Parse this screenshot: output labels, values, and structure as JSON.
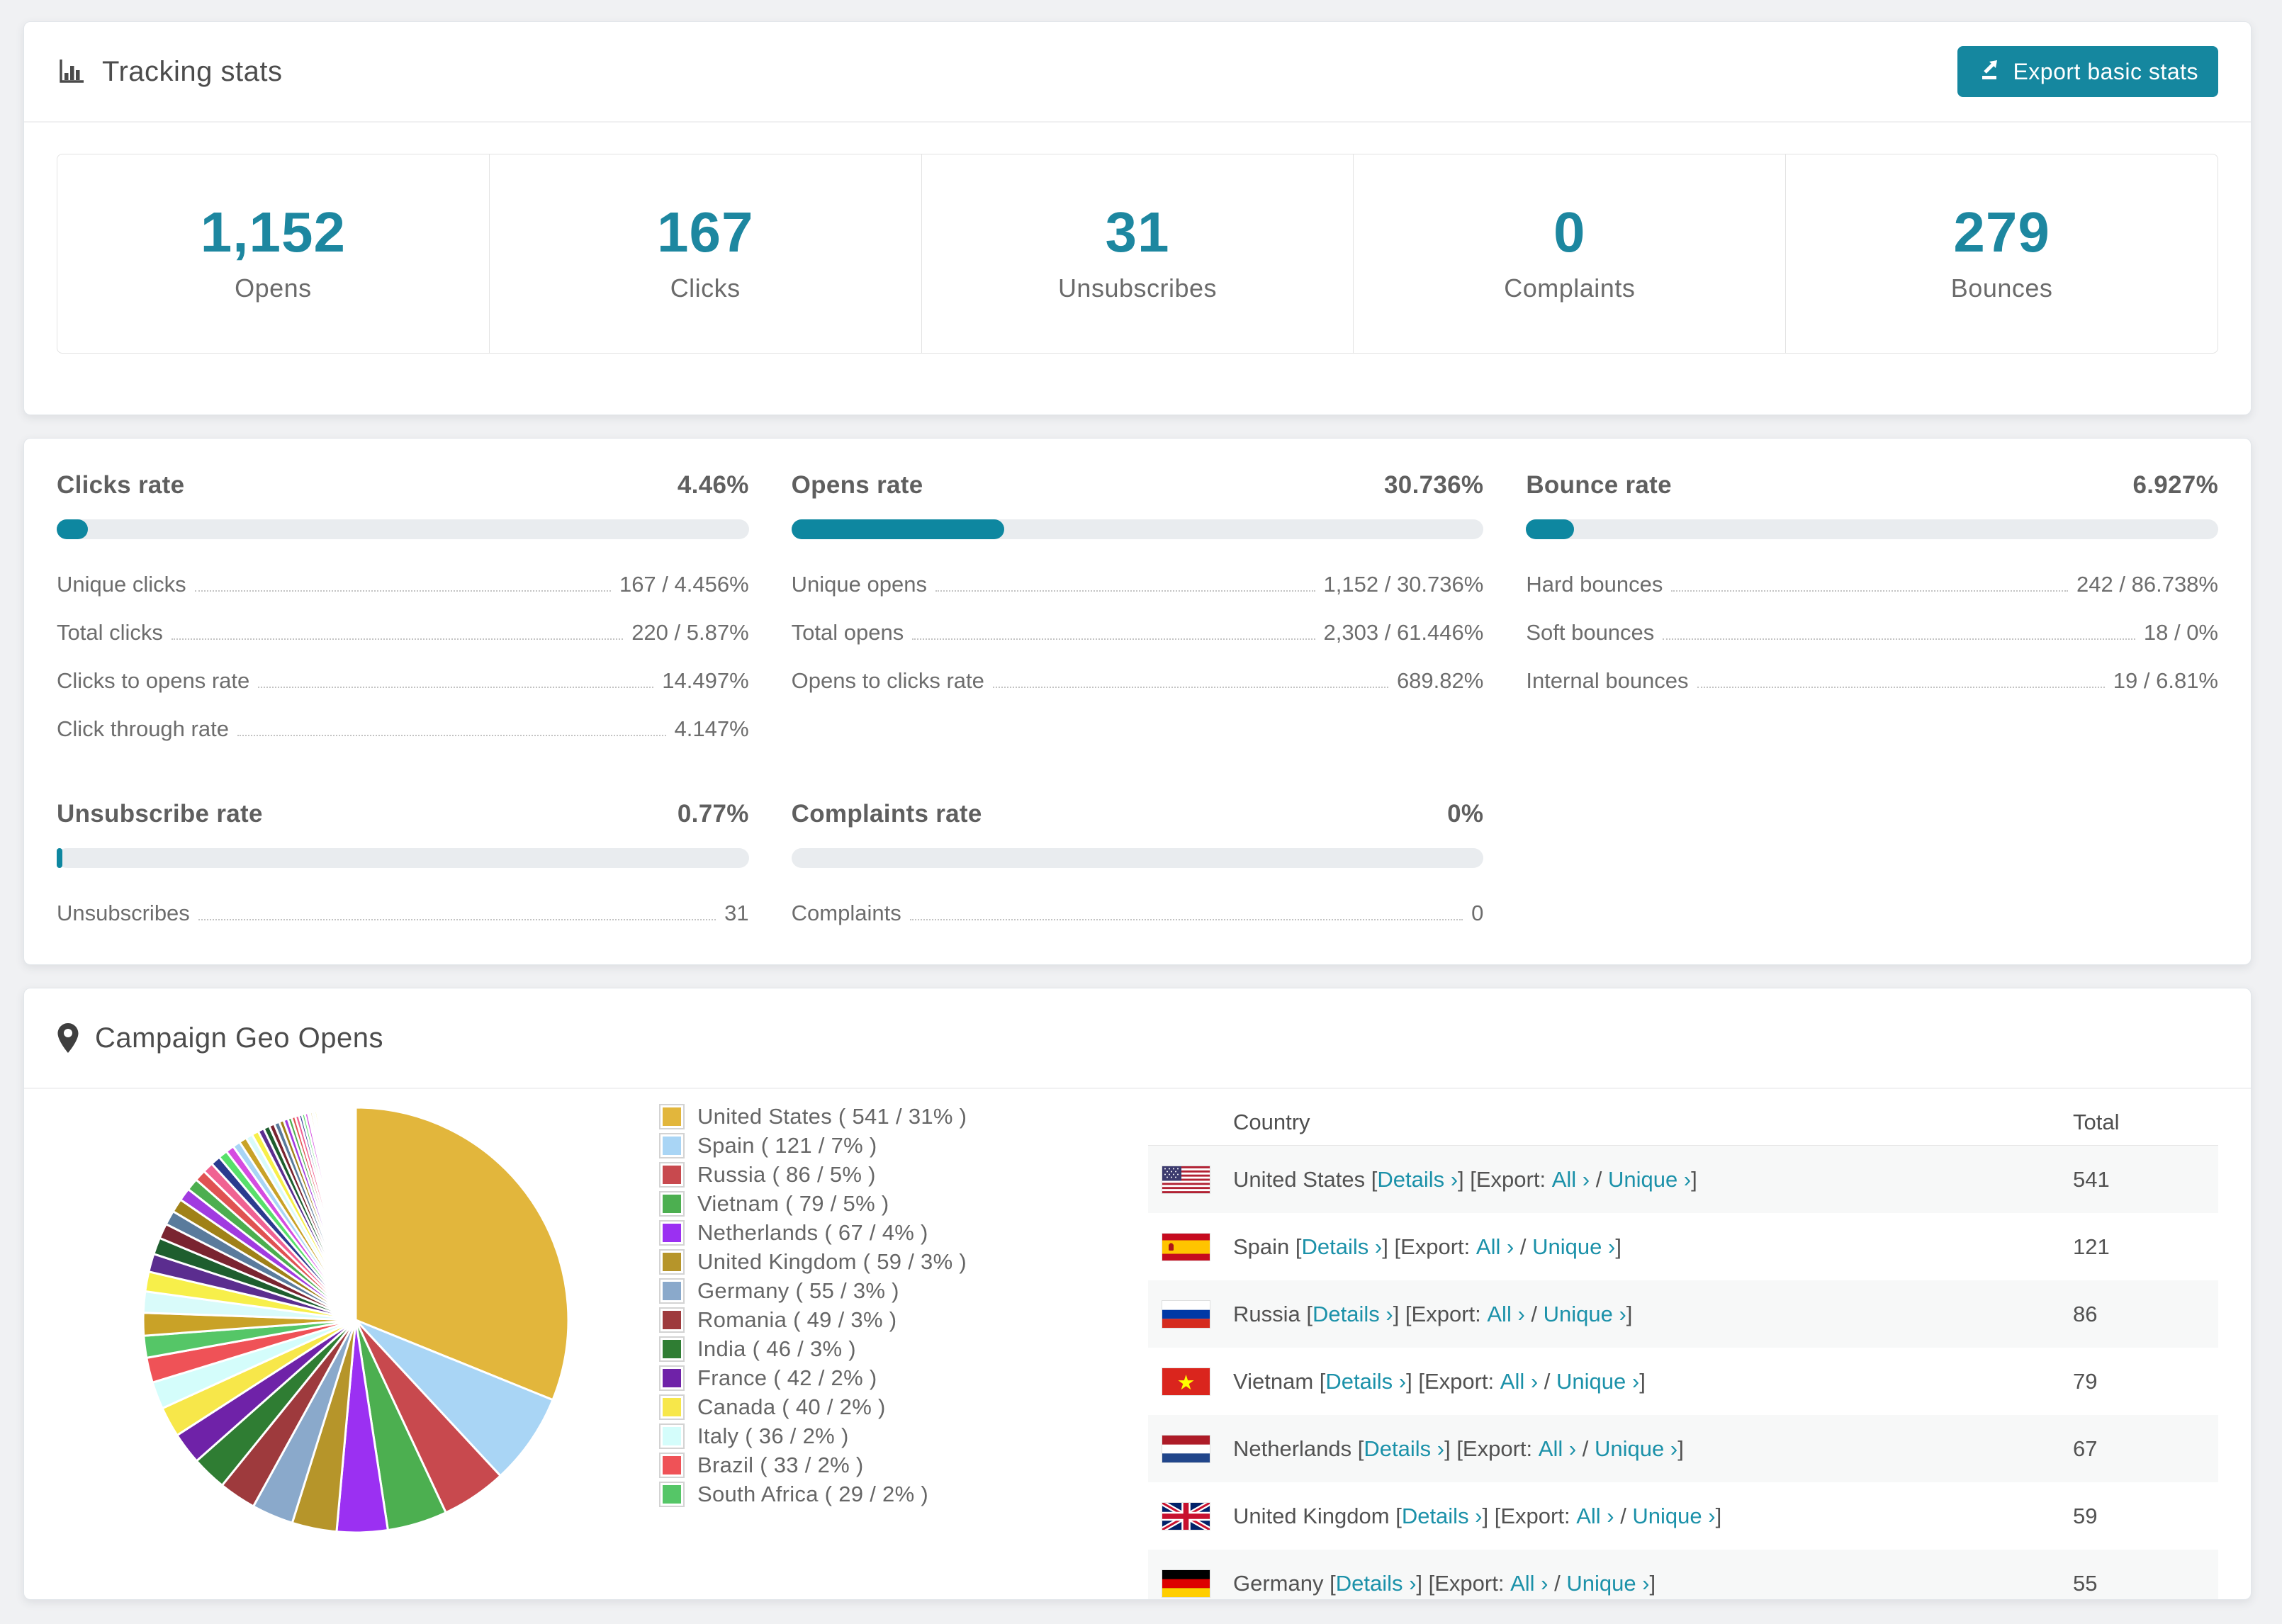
{
  "accent_color": "#15879f",
  "tracking": {
    "title": "Tracking stats",
    "export_label": "Export basic stats",
    "stats": [
      {
        "value": "1,152",
        "label": "Opens"
      },
      {
        "value": "167",
        "label": "Clicks"
      },
      {
        "value": "31",
        "label": "Unsubscribes"
      },
      {
        "value": "0",
        "label": "Complaints"
      },
      {
        "value": "279",
        "label": "Bounces"
      }
    ]
  },
  "rates": [
    {
      "title": "Clicks rate",
      "percent": "4.46%",
      "bar": 4.46,
      "rows": [
        {
          "label": "Unique clicks",
          "value": "167 / 4.456%"
        },
        {
          "label": "Total clicks",
          "value": "220 / 5.87%"
        },
        {
          "label": "Clicks to opens rate",
          "value": "14.497%"
        },
        {
          "label": "Click through rate",
          "value": "4.147%"
        }
      ]
    },
    {
      "title": "Opens rate",
      "percent": "30.736%",
      "bar": 30.736,
      "rows": [
        {
          "label": "Unique opens",
          "value": "1,152 / 30.736%"
        },
        {
          "label": "Total opens",
          "value": "2,303 / 61.446%"
        },
        {
          "label": "Opens to clicks rate",
          "value": "689.82%"
        }
      ]
    },
    {
      "title": "Bounce rate",
      "percent": "6.927%",
      "bar": 6.927,
      "rows": [
        {
          "label": "Hard bounces",
          "value": "242 / 86.738%"
        },
        {
          "label": "Soft bounces",
          "value": "18 / 0%"
        },
        {
          "label": "Internal bounces",
          "value": "19 / 6.81%"
        }
      ]
    },
    {
      "title": "Unsubscribe rate",
      "percent": "0.77%",
      "bar": 0.77,
      "rows": [
        {
          "label": "Unsubscribes",
          "value": "31"
        }
      ]
    },
    {
      "title": "Complaints rate",
      "percent": "0%",
      "bar": 0,
      "rows": [
        {
          "label": "Complaints",
          "value": "0"
        }
      ]
    }
  ],
  "geo": {
    "title": "Campaign Geo Opens",
    "table": {
      "columns": [
        "Country",
        "Total"
      ],
      "labels": {
        "lb": " [",
        "details": "Details ›",
        "mid": "] [Export: ",
        "all": "All ›",
        "slash": " / ",
        "unique": "Unique ›",
        "rb": "]"
      },
      "rows": [
        {
          "country": "United States",
          "flag": "us",
          "total": "541"
        },
        {
          "country": "Spain",
          "flag": "es",
          "total": "121"
        },
        {
          "country": "Russia",
          "flag": "ru",
          "total": "86"
        },
        {
          "country": "Vietnam",
          "flag": "vn",
          "total": "79"
        },
        {
          "country": "Netherlands",
          "flag": "nl",
          "total": "67"
        },
        {
          "country": "United Kingdom",
          "flag": "gb",
          "total": "59"
        },
        {
          "country": "Germany",
          "flag": "de",
          "total": "55"
        }
      ]
    }
  },
  "chart_data": {
    "type": "pie",
    "title": "Campaign Geo Opens",
    "legend_position": "right",
    "series": [
      {
        "name": "United States",
        "value": 541,
        "pct": "31%",
        "color": "#e2b63c",
        "legend_label": "United States ( 541 / 31% )"
      },
      {
        "name": "Spain",
        "value": 121,
        "pct": "7%",
        "color": "#a9d5f5",
        "legend_label": "Spain ( 121 / 7% )"
      },
      {
        "name": "Russia",
        "value": 86,
        "pct": "5%",
        "color": "#c8494e",
        "legend_label": "Russia ( 86 / 5% )"
      },
      {
        "name": "Vietnam",
        "value": 79,
        "pct": "5%",
        "color": "#4caf50",
        "legend_label": "Vietnam ( 79 / 5% )"
      },
      {
        "name": "Netherlands",
        "value": 67,
        "pct": "4%",
        "color": "#9b30f2",
        "legend_label": "Netherlands ( 67 / 4% )"
      },
      {
        "name": "United Kingdom",
        "value": 59,
        "pct": "3%",
        "color": "#b6952a",
        "legend_label": "United Kingdom ( 59 / 3% )"
      },
      {
        "name": "Germany",
        "value": 55,
        "pct": "3%",
        "color": "#8aa9cb",
        "legend_label": "Germany ( 55 / 3% )"
      },
      {
        "name": "Romania",
        "value": 49,
        "pct": "3%",
        "color": "#9e3a3d",
        "legend_label": "Romania ( 49 / 3% )"
      },
      {
        "name": "India",
        "value": 46,
        "pct": "3%",
        "color": "#2f7d33",
        "legend_label": "India ( 46 / 3% )"
      },
      {
        "name": "France",
        "value": 42,
        "pct": "2%",
        "color": "#6f22a8",
        "legend_label": "France ( 42 / 2% )"
      },
      {
        "name": "Canada",
        "value": 40,
        "pct": "2%",
        "color": "#f7e74a",
        "legend_label": "Canada ( 40 / 2% )"
      },
      {
        "name": "Italy",
        "value": 36,
        "pct": "2%",
        "color": "#d4fdfb",
        "legend_label": "Italy ( 36 / 2% )"
      },
      {
        "name": "Brazil",
        "value": 33,
        "pct": "2%",
        "color": "#ef5257",
        "legend_label": "Brazil ( 33 / 2% )"
      },
      {
        "name": "South Africa",
        "value": 29,
        "pct": "2%",
        "color": "#55c667",
        "legend_label": "South Africa ( 29 / 2% )"
      }
    ],
    "others_values": [
      30,
      28,
      26,
      24,
      22,
      20,
      19,
      18,
      17,
      16,
      15,
      14,
      13,
      12,
      11,
      10,
      10,
      9,
      9,
      8,
      8,
      7,
      7,
      6,
      6,
      5,
      5,
      5,
      4,
      4,
      4,
      3,
      3,
      3,
      3,
      2,
      2,
      2,
      2,
      2,
      2,
      2,
      2,
      1,
      1,
      1,
      1,
      1,
      1,
      1,
      1,
      1,
      1,
      1,
      1,
      1,
      1,
      1,
      1,
      1,
      1,
      1,
      1,
      1,
      1,
      1,
      1,
      1,
      1,
      1,
      1,
      1,
      1,
      1,
      1,
      1,
      1,
      1
    ],
    "others_palette": [
      "#c9a227",
      "#d9fbfa",
      "#f7ef4a",
      "#5b2d8f",
      "#1e5e2e",
      "#7a2430",
      "#5a7b9c",
      "#a08118",
      "#a13be0",
      "#4cae4f",
      "#e05252",
      "#f06292",
      "#2b3a8f",
      "#58e06a",
      "#d54ce0",
      "#a8d4f5"
    ]
  }
}
